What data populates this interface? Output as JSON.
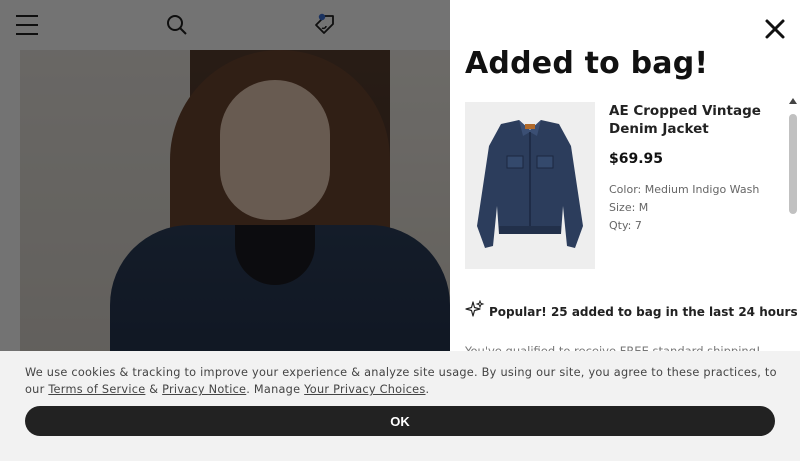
{
  "drawer": {
    "title": "Added to bag!",
    "product": {
      "name": "AE Cropped Vintage Denim Jacket",
      "price": "$69.95",
      "color": "Color: Medium Indigo Wash",
      "size": "Size: M",
      "qty": "Qty: 7"
    },
    "popular": "Popular! 25 added to bag in the last 24 hours",
    "shipping": "You've qualified to receive FREE standard shipping!"
  },
  "cookie": {
    "text_part1": "We use cookies & tracking to improve your experience & analyze site usage. By using our site, you agree to these practices, to our",
    "terms_link": "Terms of Service",
    "amp": " & ",
    "privacy_link": "Privacy Notice",
    "text_part2": ". Manage ",
    "choices_link": "Your Privacy Choices",
    "period": ".",
    "ok_label": "OK"
  },
  "colors": {
    "accent": "#222222",
    "banner_bg": "#f2f2f2",
    "overlay": "rgba(0,0,0,0.55)",
    "notification_dot": "#3b6fd6"
  },
  "icons": {
    "menu": "hamburger-menu-icon",
    "search": "search-icon",
    "tag": "tag-icon",
    "close": "close-icon",
    "sparkle": "sparkle-icon"
  }
}
